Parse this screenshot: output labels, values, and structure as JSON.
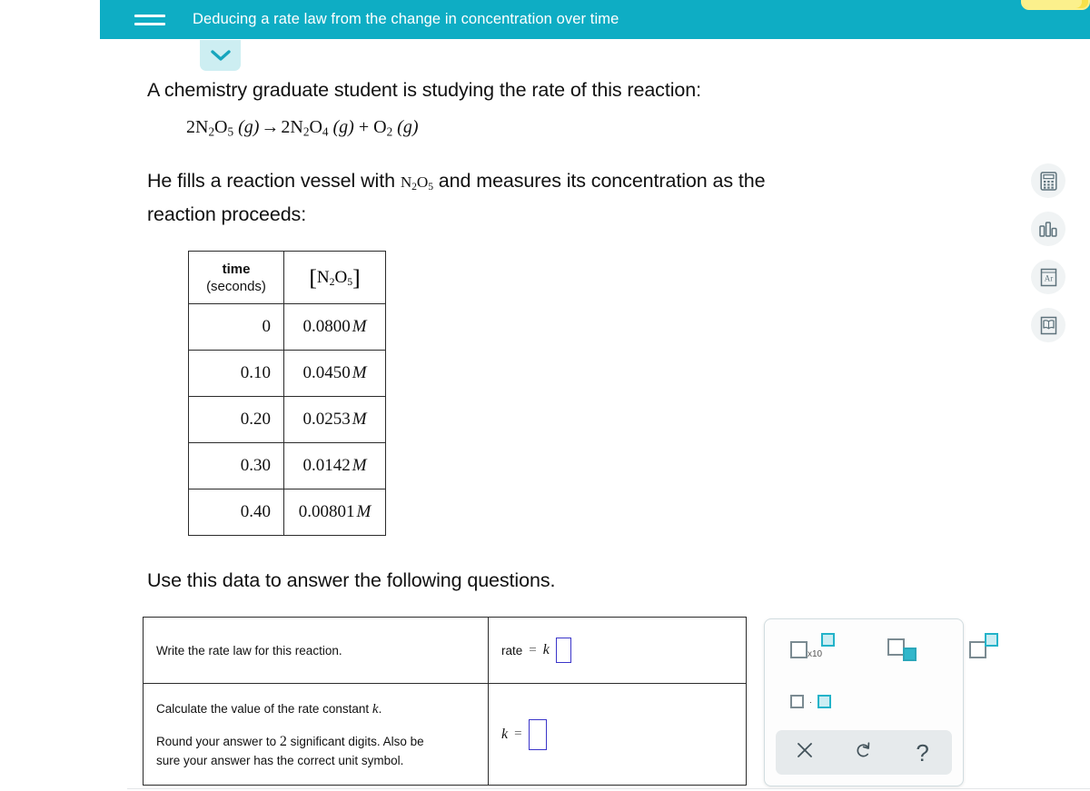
{
  "header": {
    "title": "Deducing a rate law from the change in concentration over time",
    "menu_icon": "hamburger-icon",
    "progress_label": "",
    "bar_color": "#f7e14a",
    "bg_color": "#0eadc4"
  },
  "tab": {
    "icon": "chevron-down-icon"
  },
  "intro": {
    "line1": "A chemistry graduate student is studying the rate of this reaction:",
    "equation": "2N2O5 (g) → 2N2O4 (g) + O2 (g)",
    "line2_a": "He fills a reaction vessel with ",
    "line2_species": "N2O5",
    "line2_b": " and measures its concentration as the",
    "line3": "reaction proceeds:",
    "use_data": "Use this data to answer the following questions."
  },
  "table": {
    "headers": {
      "time": "time",
      "time_units": "(seconds)",
      "conc": "[N2O5]"
    },
    "rows": [
      {
        "time": "0",
        "conc": "0.0800",
        "unit": "M"
      },
      {
        "time": "0.10",
        "conc": "0.0450",
        "unit": "M"
      },
      {
        "time": "0.20",
        "conc": "0.0253",
        "unit": "M"
      },
      {
        "time": "0.30",
        "conc": "0.0142",
        "unit": "M"
      },
      {
        "time": "0.40",
        "conc": "0.00801",
        "unit": "M"
      }
    ]
  },
  "questions": [
    {
      "prompt": "Write the rate law for this reaction.",
      "answer_label": "rate",
      "answer_eq": "=",
      "answer_k": "k",
      "input_value": ""
    },
    {
      "prompt_part1": "Calculate the value of the rate constant ",
      "prompt_k": "k",
      "prompt_part1_end": ".",
      "prompt_part2_a": "Round your answer to ",
      "prompt_sig": "2",
      "prompt_part2_b": " significant digits. Also be",
      "prompt_part3": "sure your answer has the correct unit symbol.",
      "answer_k": "k",
      "answer_eq": "=",
      "input_value": ""
    }
  ],
  "keypad": {
    "buttons": [
      {
        "name": "scientific-notation-button",
        "label": "x10"
      },
      {
        "name": "subscript-button",
        "label": ""
      },
      {
        "name": "superscript-button",
        "label": ""
      },
      {
        "name": "multiplication-dot-button",
        "label": "·"
      }
    ],
    "actions": [
      {
        "name": "clear-button",
        "glyph": "✕"
      },
      {
        "name": "undo-button",
        "glyph": "↺"
      },
      {
        "name": "help-button",
        "glyph": "?"
      }
    ],
    "accent_color": "#23b3c9"
  },
  "rail": {
    "items": [
      {
        "name": "calculator-icon",
        "label": "Calculator"
      },
      {
        "name": "bar-chart-icon",
        "label": "Data"
      },
      {
        "name": "periodic-table-icon",
        "label": "Ar"
      },
      {
        "name": "reference-book-icon",
        "label": "Reference"
      }
    ]
  }
}
